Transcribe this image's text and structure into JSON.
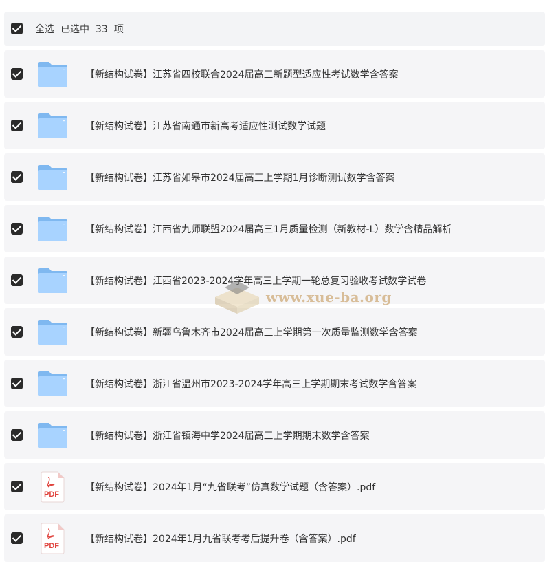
{
  "header": {
    "select_all_label": "全选",
    "selected_prefix": "已选中",
    "selected_count": "33",
    "selected_suffix": "项"
  },
  "items": [
    {
      "label": "【新结构试卷】江苏省四校联合2024届高三新题型适应性考试数学含答案",
      "type": "folder-icon"
    },
    {
      "label": "【新结构试卷】江苏省南通市新高考适应性测试数学试题",
      "type": "folder-icon"
    },
    {
      "label": "【新结构试卷】江苏省如皋市2024届高三上学期1月诊断测试数学含答案",
      "type": "folder-icon"
    },
    {
      "label": "【新结构试卷】江西省九师联盟2024届高三1月质量检测（新教材-L）数学含精品解析",
      "type": "folder-icon"
    },
    {
      "label": "【新结构试卷】江西省2023-2024学年高三上学期一轮总复习验收考试数学试卷",
      "type": "folder-icon"
    },
    {
      "label": "【新结构试卷】新疆乌鲁木齐市2024届高三上学期第一次质量监测数学含答案",
      "type": "folder-icon"
    },
    {
      "label": "【新结构试卷】浙江省温州市2023-2024学年高三上学期期末考试数学含答案",
      "type": "folder-icon"
    },
    {
      "label": "【新结构试卷】浙江省镇海中学2024届高三上学期期末数学含答案",
      "type": "folder-icon"
    },
    {
      "label": "【新结构试卷】2024年1月“九省联考”仿真数学试题（含答案）.pdf",
      "type": "pdf-icon",
      "badge": "PDF"
    },
    {
      "label": "【新结构试卷】2024年1月九省联考考后提升卷（含答案）.pdf",
      "type": "pdf-icon",
      "badge": "PDF"
    }
  ],
  "watermark": {
    "text": "www.xue-ba.org"
  },
  "colors": {
    "folder_back": "#7fb8f0",
    "folder_front": "#a8d3ff",
    "pdf_red": "#e0443e",
    "row_bg": "#f5f5f7",
    "checkbox": "#2b2b2b"
  }
}
